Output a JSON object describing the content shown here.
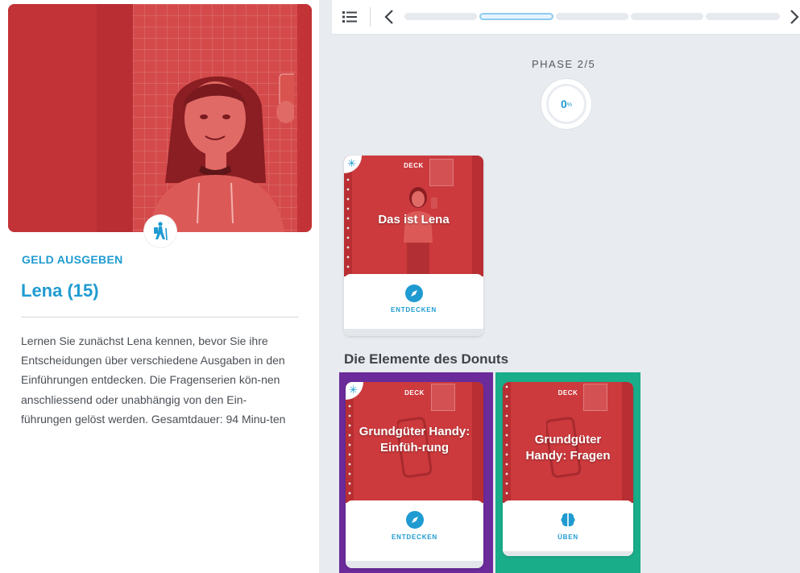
{
  "sidebar": {
    "category": "GELD AUSGEBEN",
    "title": "Lena (15)",
    "description": "Lernen Sie zunächst Lena kennen, bevor Sie ihre Entscheidungen über verschiedene Ausgaben in den Einführungen entdecken. Die Fragenserien kön-nen anschliessend oder unabhängig von den Ein-führungen gelöst werden. Gesamtdauer: 94 Minu-ten",
    "badge_icon": "hiker-icon"
  },
  "topbar": {
    "menu_icon": "list-icon",
    "prev_icon": "chevron-left-icon",
    "next_icon": "chevron-right-icon",
    "phases_total": 5,
    "active_phase_index": 1
  },
  "phase": {
    "label": "PHASE 2/5",
    "progress_value": "0",
    "progress_unit": "%"
  },
  "section_title": "Die Elemente des Donuts",
  "cards": [
    {
      "deck": "DECK",
      "title": "Das ist Lena",
      "action": "ENTDECKEN",
      "action_icon": "compass-icon",
      "new_icon": "asterisk-icon"
    },
    {
      "deck": "DECK",
      "title": "Grundgüter Handy: Einfüh-rung",
      "action": "ENTDECKEN",
      "action_icon": "compass-icon",
      "new_icon": "asterisk-icon",
      "highlight": "#6b2b9b"
    },
    {
      "deck": "DECK",
      "title": "Grundgüter Handy: Fragen",
      "action": "ÜBEN",
      "action_icon": "brain-icon",
      "highlight": "#1aad8a"
    }
  ],
  "colors": {
    "accent": "#1f9bd1",
    "card_red": "#cc3a3d",
    "highlight_purple": "#6b2b9b",
    "highlight_teal": "#1aad8a"
  }
}
